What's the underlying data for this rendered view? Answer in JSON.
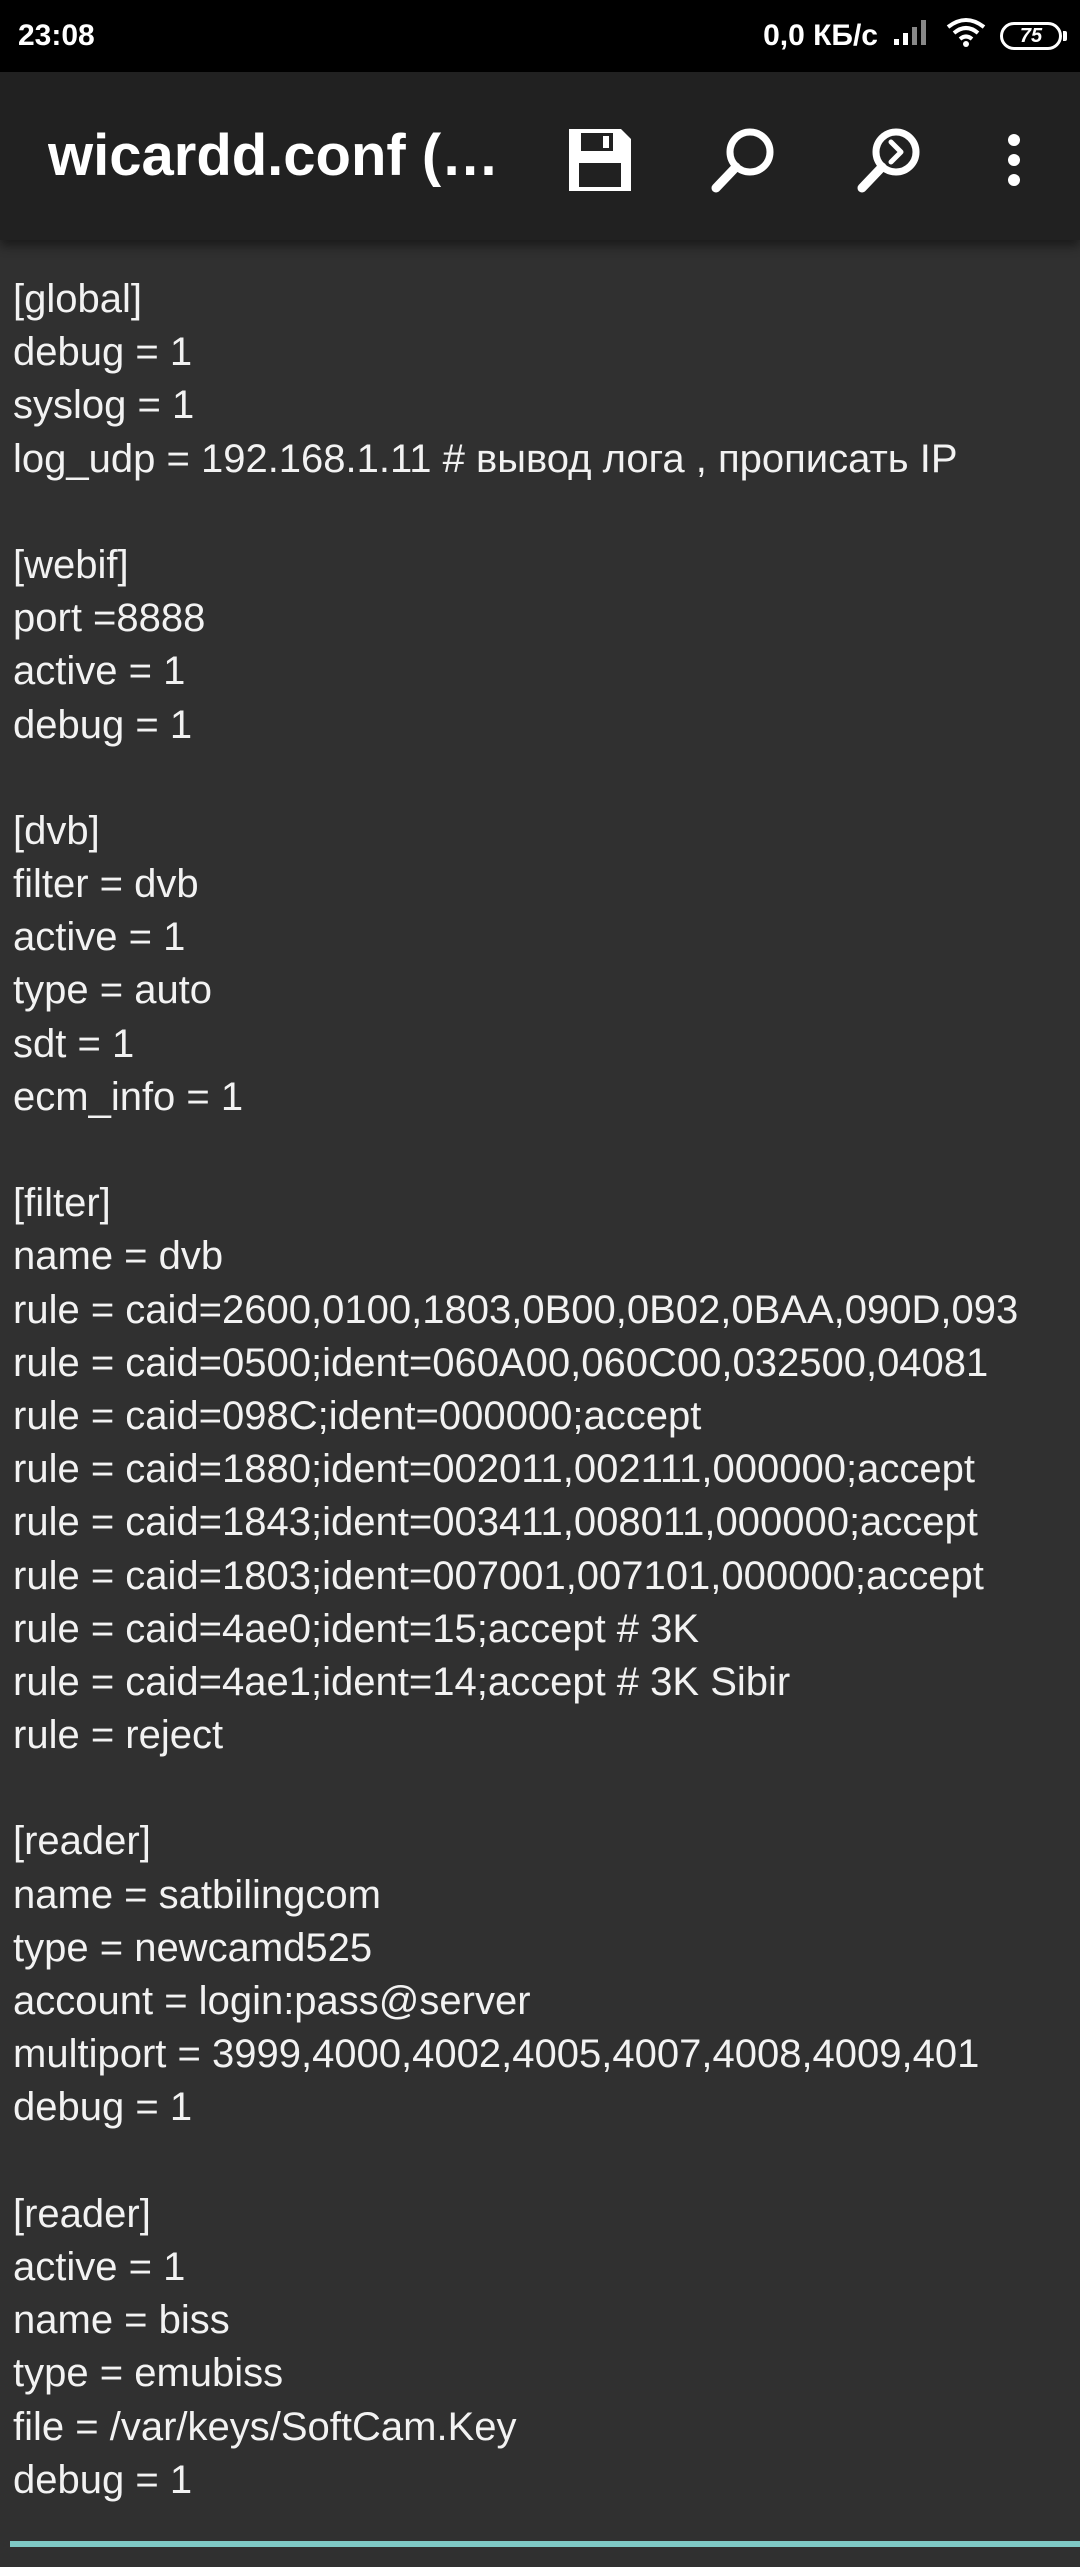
{
  "status_bar": {
    "time": "23:08",
    "network_speed": "0,0 КБ/с",
    "battery_level": "75",
    "icons": [
      "signal-icon",
      "wifi-icon",
      "battery-icon"
    ]
  },
  "toolbar": {
    "title": "wicardd.conf (…",
    "icons": [
      "save-icon",
      "search-icon",
      "find-next-icon",
      "more-vert-icon"
    ]
  },
  "editor": {
    "lines": [
      "[global]",
      "debug = 1",
      "syslog = 1",
      "log_udp = 192.168.1.11 # вывод лога , прописать IP",
      "",
      "[webif]",
      "port =8888",
      "active = 1",
      "debug = 1",
      "",
      "[dvb]",
      "filter = dvb",
      "active = 1",
      "type = auto",
      "sdt = 1",
      "ecm_info = 1",
      "",
      "[filter]",
      "name = dvb",
      "rule = caid=2600,0100,1803,0B00,0B02,0BAA,090D,093",
      "rule = caid=0500;ident=060A00,060C00,032500,04081",
      "rule = caid=098C;ident=000000;accept",
      "rule = caid=1880;ident=002011,002111,000000;accept",
      "rule = caid=1843;ident=003411,008011,000000;accept",
      "rule = caid=1803;ident=007001,007101,000000;accept",
      "rule = caid=4ae0;ident=15;accept # 3K",
      "rule = caid=4ae1;ident=14;accept # 3K Sibir",
      "rule = reject",
      "",
      "[reader]",
      "name = satbilingcom",
      "type = newcamd525",
      "account = login:pass@server",
      "multiport = 3999,4000,4002,4005,4007,4008,4009,401",
      "debug = 1",
      "",
      "[reader]",
      "active = 1",
      "name = biss",
      "type = emubiss",
      "file = /var/keys/SoftCam.Key",
      "debug = 1"
    ]
  }
}
